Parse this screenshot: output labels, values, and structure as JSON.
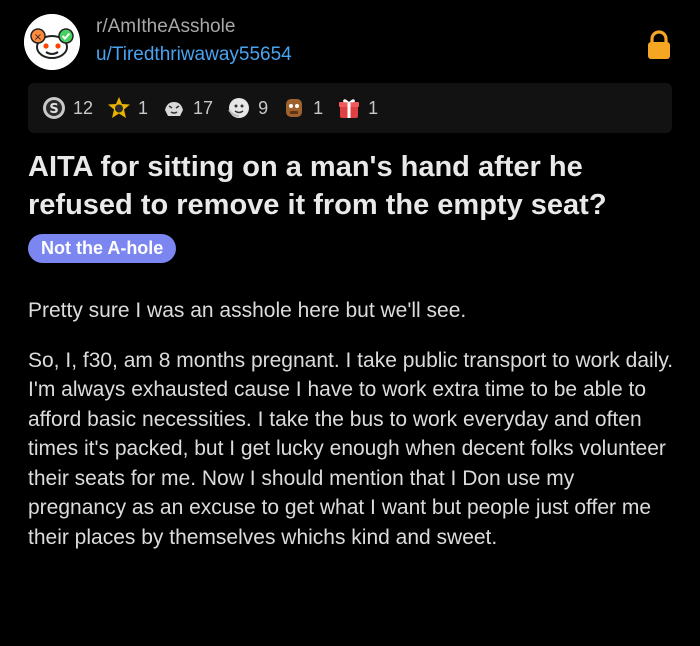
{
  "header": {
    "subreddit": "r/AmItheAsshole",
    "username": "u/Tiredthriwaway55654"
  },
  "awards": [
    {
      "icon": "silver-icon",
      "count": "12"
    },
    {
      "icon": "helpful-icon",
      "count": "1"
    },
    {
      "icon": "wholesome-icon",
      "count": "17"
    },
    {
      "icon": "hugz-icon",
      "count": "9"
    },
    {
      "icon": "bravo-icon",
      "count": "1"
    },
    {
      "icon": "gift-icon",
      "count": "1"
    }
  ],
  "post": {
    "title": "AITA for sitting on a man's hand after he refused to remove it from the empty seat?",
    "flair": "Not the A-hole",
    "paragraphs": [
      "Pretty sure I was an asshole here but we'll see.",
      "So, I, f30, am 8 months pregnant. I take public transport to work daily. I'm always exhausted cause I have to work extra time to be able to afford basic necessities. I take the bus to work everyday and often times it's packed, but I get lucky enough when decent folks volunteer their seats for me. Now I should mention that I Don use my pregnancy as an excuse to get what I want but people just offer me their places by themselves whichs kind and sweet."
    ]
  },
  "colors": {
    "background": "#000000",
    "username": "#4aa3f0",
    "flair": "#7b86f0",
    "lock": "#f5a623"
  }
}
